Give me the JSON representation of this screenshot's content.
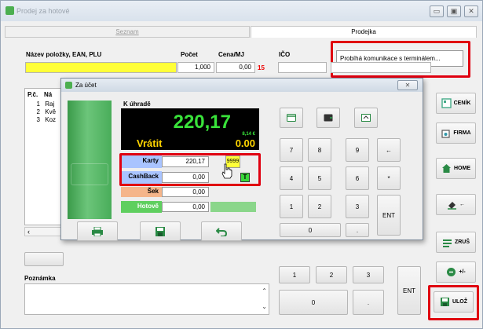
{
  "window": {
    "title": "Prodej za hotové",
    "min_label": "▭",
    "max_label": "▣",
    "close_label": "✕"
  },
  "tabs": {
    "list_label": "Seznam",
    "receipt_label": "Prodejka"
  },
  "item_form": {
    "name_label": "Název položky, EAN, PLU",
    "qty_label": "Počet",
    "price_label": "Cena/MJ",
    "ico_label": "IČO",
    "qty_value": "1,000",
    "price_value": "0,00",
    "price_flag": "15"
  },
  "terminal_message": "Probíhá komunikace s terminálem...",
  "table": {
    "col_no": "P.č.",
    "col_name": "Ná",
    "rows": [
      {
        "no": "1",
        "name": "Raj"
      },
      {
        "no": "2",
        "name": "Kvě"
      },
      {
        "no": "3",
        "name": "Koz"
      }
    ]
  },
  "note_label": "Poznámka",
  "side_buttons": {
    "pricelist": "CENÍK",
    "company": "FIRMA",
    "home": "HOME",
    "cancel": "ZRUŠ",
    "save": "ULOŽ",
    "plusminus": "+/-",
    "erase_arrow": "←"
  },
  "dialog": {
    "title": "Za účet",
    "close_label": "✕",
    "to_pay_label": "K úhradě",
    "total": "220,17",
    "eur_value": "8,14 €",
    "change_label": "Vrátit",
    "change_value": "0.00",
    "payments": [
      {
        "label": "Karty",
        "value": "220,17"
      },
      {
        "label": "CashBack",
        "value": "0,00"
      },
      {
        "label": "Šek",
        "value": "0,00"
      },
      {
        "label": "Hotově",
        "value": "0,00"
      }
    ],
    "terminal_id": "9999",
    "t_badge": "T"
  },
  "keypad": {
    "k7": "7",
    "k8": "8",
    "k9": "9",
    "back": "←",
    "k4": "4",
    "k5": "5",
    "k6": "6",
    "star": "*",
    "k1": "1",
    "k2": "2",
    "k3": "3",
    "ent": "ENT",
    "k0": "0",
    "dot": "."
  },
  "colors": {
    "highlight_red": "#e00010",
    "field_yellow": "#ffff38",
    "amount_green": "#39e23a",
    "change_yellow": "#ffd500",
    "card_blue": "#a9c4ff",
    "cheque_orange": "#f5b58a",
    "cash_green": "#5fcf5f"
  }
}
